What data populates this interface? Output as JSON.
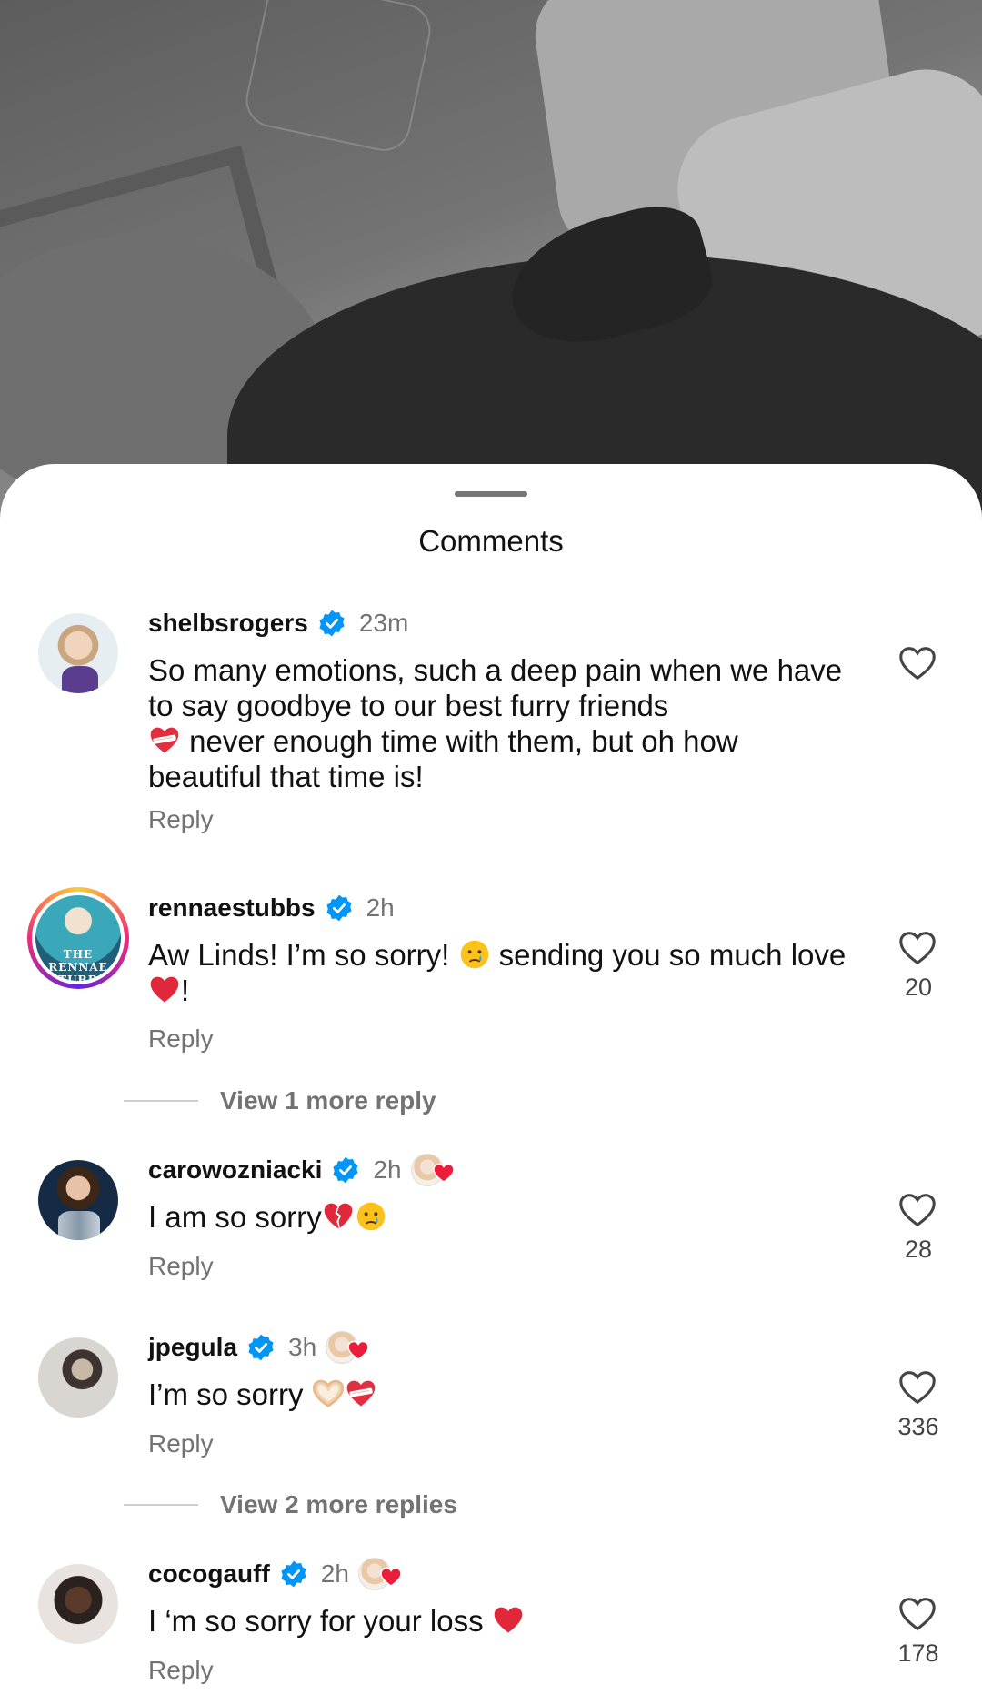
{
  "sheet": {
    "title": "Comments"
  },
  "comments": [
    {
      "username": "shelbsrogers",
      "verified": true,
      "time": "23m",
      "text_a": "So many emotions, such a deep pain when we have to say goodbye to our best furry friends",
      "text_b": "never enough time with them, but oh how beautiful that time is!",
      "reply": "Reply",
      "likes": ""
    },
    {
      "username": "rennaestubbs",
      "verified": true,
      "time": "2h",
      "text_a": "Aw Linds! I’m so sorry!",
      "text_b": "sending you so much love",
      "text_c": "!",
      "avatar_text": "THE RENNAE STUBBS TENNIS PODCAST",
      "reply": "Reply",
      "likes": "20",
      "view_more": "View 1 more reply"
    },
    {
      "username": "carowozniacki",
      "verified": true,
      "time": "2h",
      "text_a": "I am so sorry",
      "reply": "Reply",
      "likes": "28"
    },
    {
      "username": "jpegula",
      "verified": true,
      "time": "3h",
      "text_a": "I’m so sorry",
      "reply": "Reply",
      "likes": "336",
      "view_more": "View 2 more replies"
    },
    {
      "username": "cocogauff",
      "verified": true,
      "time": "2h",
      "text_a": "I ‘m so sorry for your loss",
      "reply": "Reply",
      "likes": "178"
    }
  ],
  "colors": {
    "verified": "#0095f6",
    "heart_red": "#ed4956",
    "secondary_text": "#737373"
  }
}
